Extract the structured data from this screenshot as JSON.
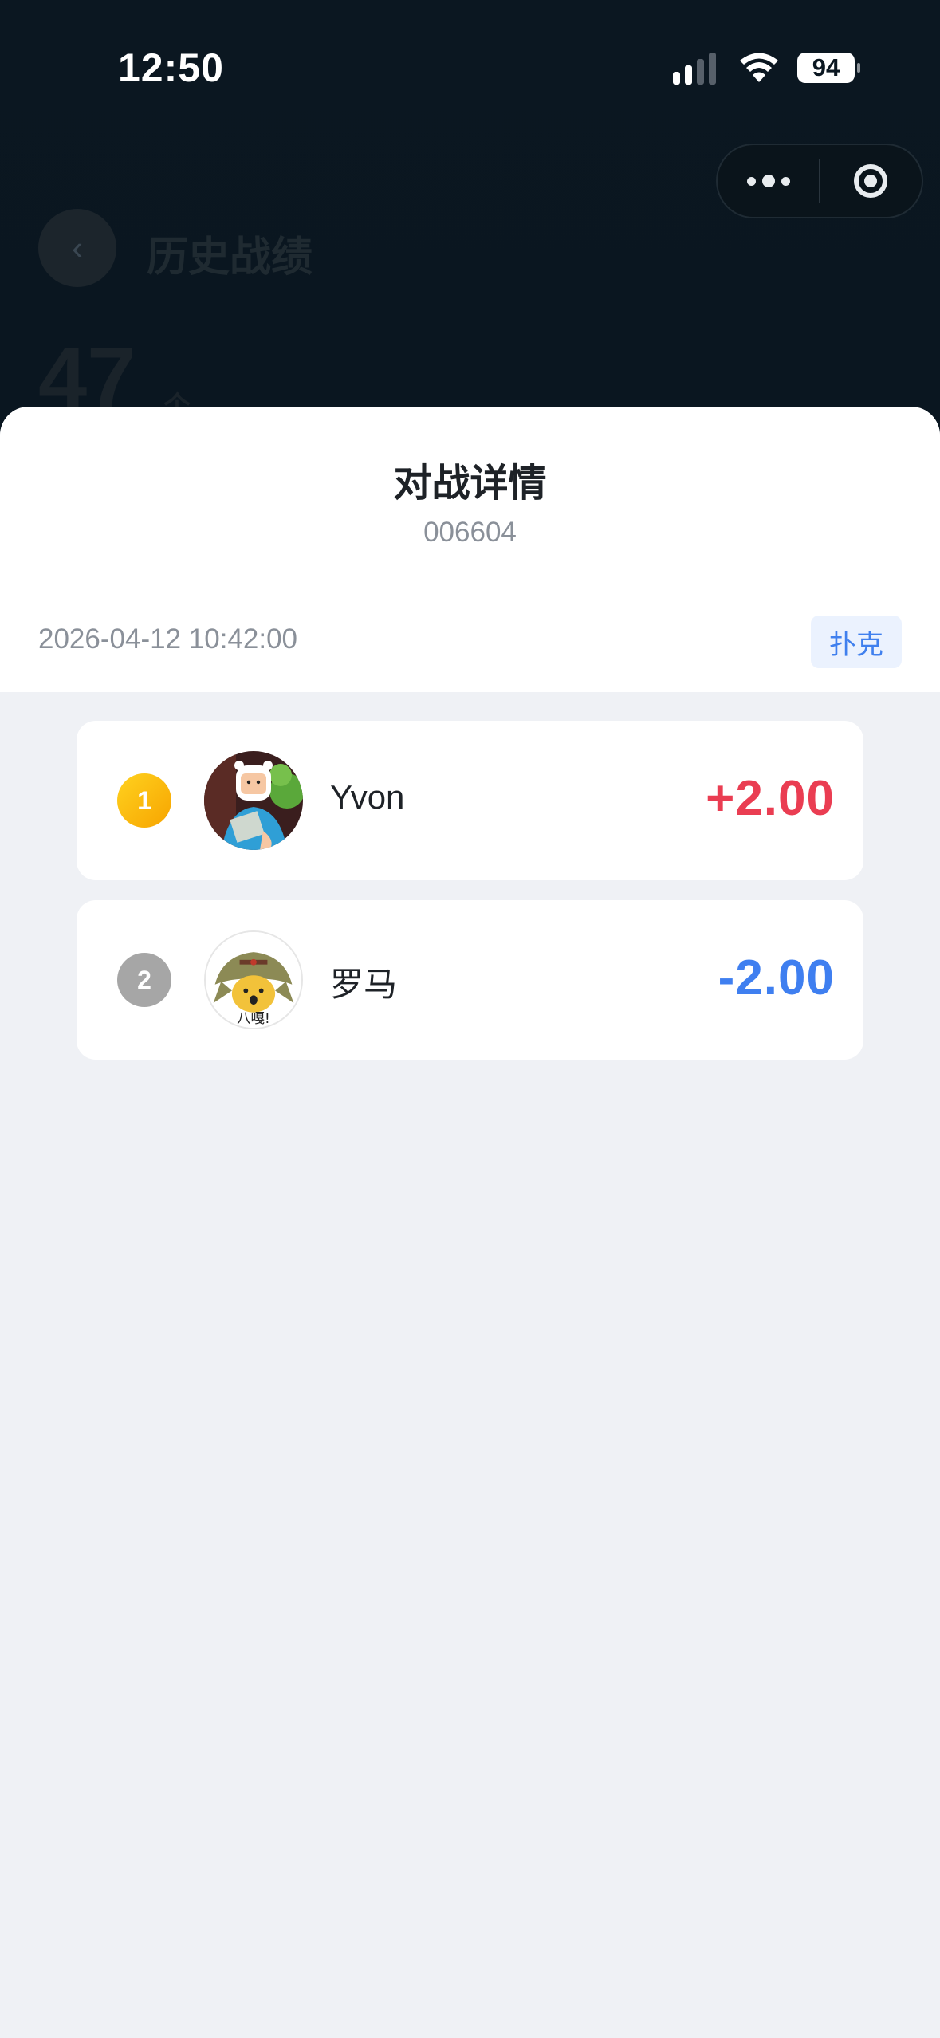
{
  "status_bar": {
    "time": "12:50",
    "battery": "94"
  },
  "background_page": {
    "back_icon": "chevron-left-icon",
    "title": "历史战绩",
    "count": "47",
    "count_unit": "个"
  },
  "capsule": {
    "more_icon": "more-dots-icon",
    "close_icon": "close-circle-icon"
  },
  "sheet": {
    "title": "对战详情",
    "room_code": "006604",
    "datetime": "2026-04-12 10:42:00",
    "game_tag": "扑克"
  },
  "players": [
    {
      "rank": "1",
      "avatar": "cartoon-boy-reading-avatar",
      "name": "Yvon",
      "score": "+2.00"
    },
    {
      "rank": "2",
      "avatar": "shiba-dog-soldier-hat-avatar",
      "avatar_caption": "八嘎!",
      "name": "罗马",
      "score": "-2.00"
    }
  ],
  "colors": {
    "positive": "#ea3d52",
    "negative": "#3f7ff0",
    "gold_rank": "#f7a400",
    "silver_rank": "#a6a6a6",
    "tag_text": "#4080ee",
    "tag_bg": "#ebf2fe"
  }
}
